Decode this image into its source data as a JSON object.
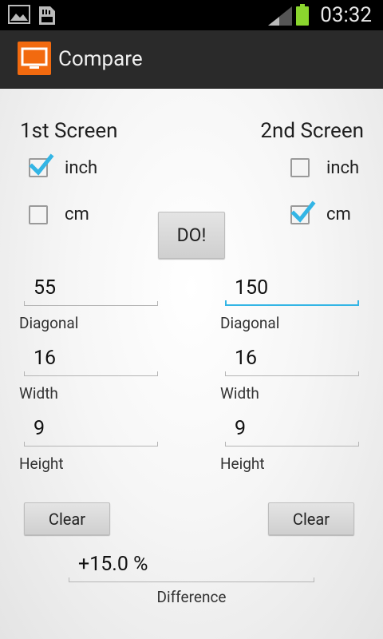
{
  "status_bar": {
    "time": "03:32",
    "battery_color": "#8bd62e"
  },
  "action_bar": {
    "title": "Compare",
    "icon_color": "#f26a0f"
  },
  "screen1": {
    "header": "1st Screen",
    "unit_inch": {
      "label": "inch",
      "checked": true
    },
    "unit_cm": {
      "label": "cm",
      "checked": false
    },
    "diagonal": {
      "value": "55",
      "label": "Diagonal"
    },
    "width": {
      "value": "16",
      "label": "Width"
    },
    "height": {
      "value": "9",
      "label": "Height"
    },
    "clear_label": "Clear"
  },
  "screen2": {
    "header": "2nd Screen",
    "unit_inch": {
      "label": "inch",
      "checked": false
    },
    "unit_cm": {
      "label": "cm",
      "checked": true
    },
    "diagonal": {
      "value": "150",
      "label": "Diagonal"
    },
    "width": {
      "value": "16",
      "label": "Width"
    },
    "height": {
      "value": "9",
      "label": "Height"
    },
    "clear_label": "Clear"
  },
  "do_button_label": "DO!",
  "difference": {
    "value": "+15.0 %",
    "label": "Difference"
  },
  "accent_color": "#33b5e5"
}
